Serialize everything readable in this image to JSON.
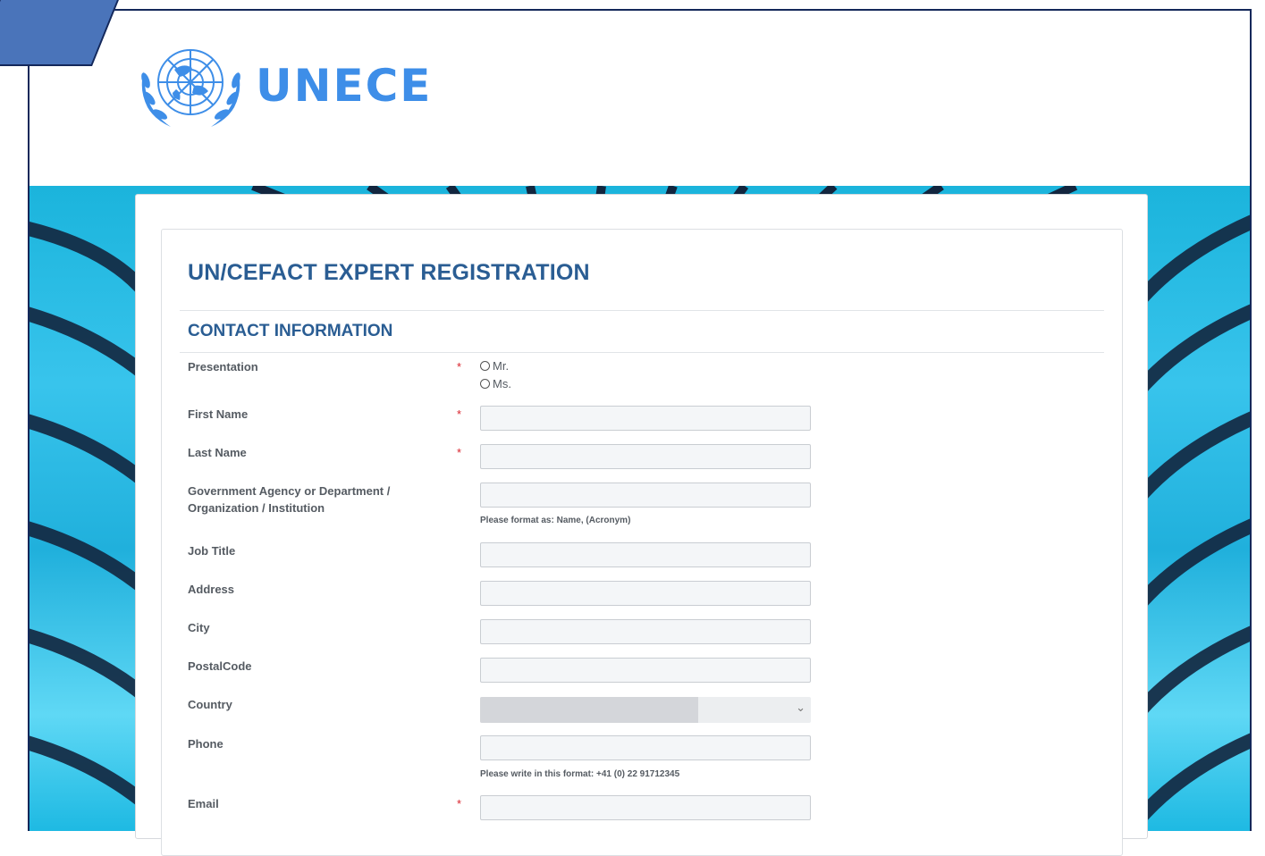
{
  "brand": {
    "logo_text": "UNECE"
  },
  "form": {
    "title": "UN/CEFACT EXPERT REGISTRATION",
    "section": "CONTACT INFORMATION",
    "required_mark": "*",
    "presentation": {
      "label": "Presentation",
      "options": [
        "Mr.",
        "Ms."
      ]
    },
    "first_name": {
      "label": "First Name",
      "value": ""
    },
    "last_name": {
      "label": "Last Name",
      "value": ""
    },
    "organization": {
      "label_line1": "Government Agency or Department /",
      "label_line2": "Organization / Institution",
      "help": "Please format as: Name, (Acronym)",
      "value": ""
    },
    "job_title": {
      "label": "Job Title",
      "value": ""
    },
    "address": {
      "label": "Address",
      "value": ""
    },
    "city": {
      "label": "City",
      "value": ""
    },
    "postal_code": {
      "label": "PostalCode",
      "value": ""
    },
    "country": {
      "label": "Country",
      "selected": ""
    },
    "phone": {
      "label": "Phone",
      "help": "Please write in this format: +41 (0) 22 91712345",
      "value": ""
    },
    "email": {
      "label": "Email",
      "value": ""
    }
  },
  "colors": {
    "heading": "#2a5d93",
    "logo": "#3e8ee8",
    "required": "#d9232c",
    "frame": "#14285a"
  }
}
